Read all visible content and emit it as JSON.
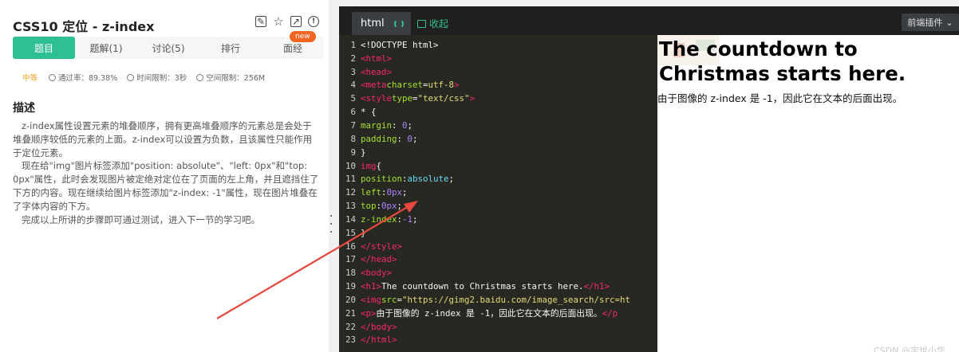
{
  "left_panel": {
    "title": "CSS10  定位 - z-index",
    "tabs": [
      {
        "label": "题目",
        "active": true
      },
      {
        "label": "题解(1)",
        "active": false
      },
      {
        "label": "讨论(5)",
        "active": false
      },
      {
        "label": "排行",
        "active": false
      },
      {
        "label": "面经",
        "active": false
      }
    ],
    "badge_new": "new",
    "stats": {
      "difficulty": "中等",
      "pass_rate": "通过率：89.38%",
      "time_limit": "时间限制：3秒",
      "memory_limit": "空间限制：256M"
    },
    "desc_heading": "描述",
    "desc_paragraphs": [
      "z-index属性设置元素的堆叠顺序，拥有更高堆叠顺序的元素总是会处于堆叠顺序较低的元素的上面。z-index可以设置为负数，且该属性只能作用于定位元素。",
      "现在给\"img\"图片标签添加\"position: absolute\"、\"left: 0px\"和\"top: 0px\"属性，此时会发现图片被定绝对定位在了页面的左上角，并且遮挡住了下方的内容。现在继续给图片标签添加\"z-index: -1\"属性，现在图片堆叠在了字体内容的下方。",
      "完成以上所讲的步骤即可通过测试，进入下一节的学习吧。"
    ]
  },
  "editor": {
    "tab_label": "html",
    "collapse_label": "收起",
    "plugin_label": "前端插件"
  },
  "preview": {
    "heading": "The countdown to Christmas starts here.",
    "paragraph": "由于图像的 z-index 是 -1，因此它在文本的后面出现。"
  },
  "colors": {
    "accent": "#2fbf95",
    "badge": "#f26522",
    "editor_bg": "#272822",
    "arrow": "#e8483e"
  },
  "watermark": "CSDN @宇世小华"
}
